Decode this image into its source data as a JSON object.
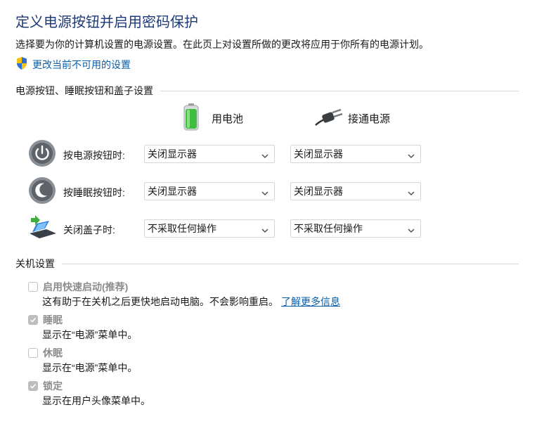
{
  "page": {
    "title": "定义电源按钮并启用密码保护",
    "subtitle": "选择要为你的计算机设置的电源设置。在此页上对设置所做的更改将应用于你所有的电源计划。",
    "change_link": "更改当前不可用的设置"
  },
  "buttons_section": {
    "header": "电源按钮、睡眠按钮和盖子设置",
    "columns": {
      "battery": "用电池",
      "plugged": "接通电源"
    },
    "rows": [
      {
        "label": "按电源按钮时:",
        "battery": "关闭显示器",
        "plugged": "关闭显示器",
        "icon": "power-button-icon"
      },
      {
        "label": "按睡眠按钮时:",
        "battery": "关闭显示器",
        "plugged": "关闭显示器",
        "icon": "sleep-button-icon"
      },
      {
        "label": "关闭盖子时:",
        "battery": "不采取任何操作",
        "plugged": "不采取任何操作",
        "icon": "laptop-lid-icon"
      }
    ]
  },
  "shutdown_section": {
    "header": "关机设置",
    "options": [
      {
        "label": "启用快速启动(推荐)",
        "checked": false,
        "desc": "这有助于在关机之后更快地启动电脑。不会影响重启。",
        "link": "了解更多信息"
      },
      {
        "label": "睡眠",
        "checked": true,
        "desc": "显示在“电源”菜单中。"
      },
      {
        "label": "休眠",
        "checked": false,
        "desc": "显示在“电源”菜单中。"
      },
      {
        "label": "锁定",
        "checked": true,
        "desc": "显示在用户头像菜单中。"
      }
    ]
  },
  "colors": {
    "title": "#1e3a78",
    "link": "#0b5fa8",
    "disabled_text": "#8c8c8c"
  }
}
